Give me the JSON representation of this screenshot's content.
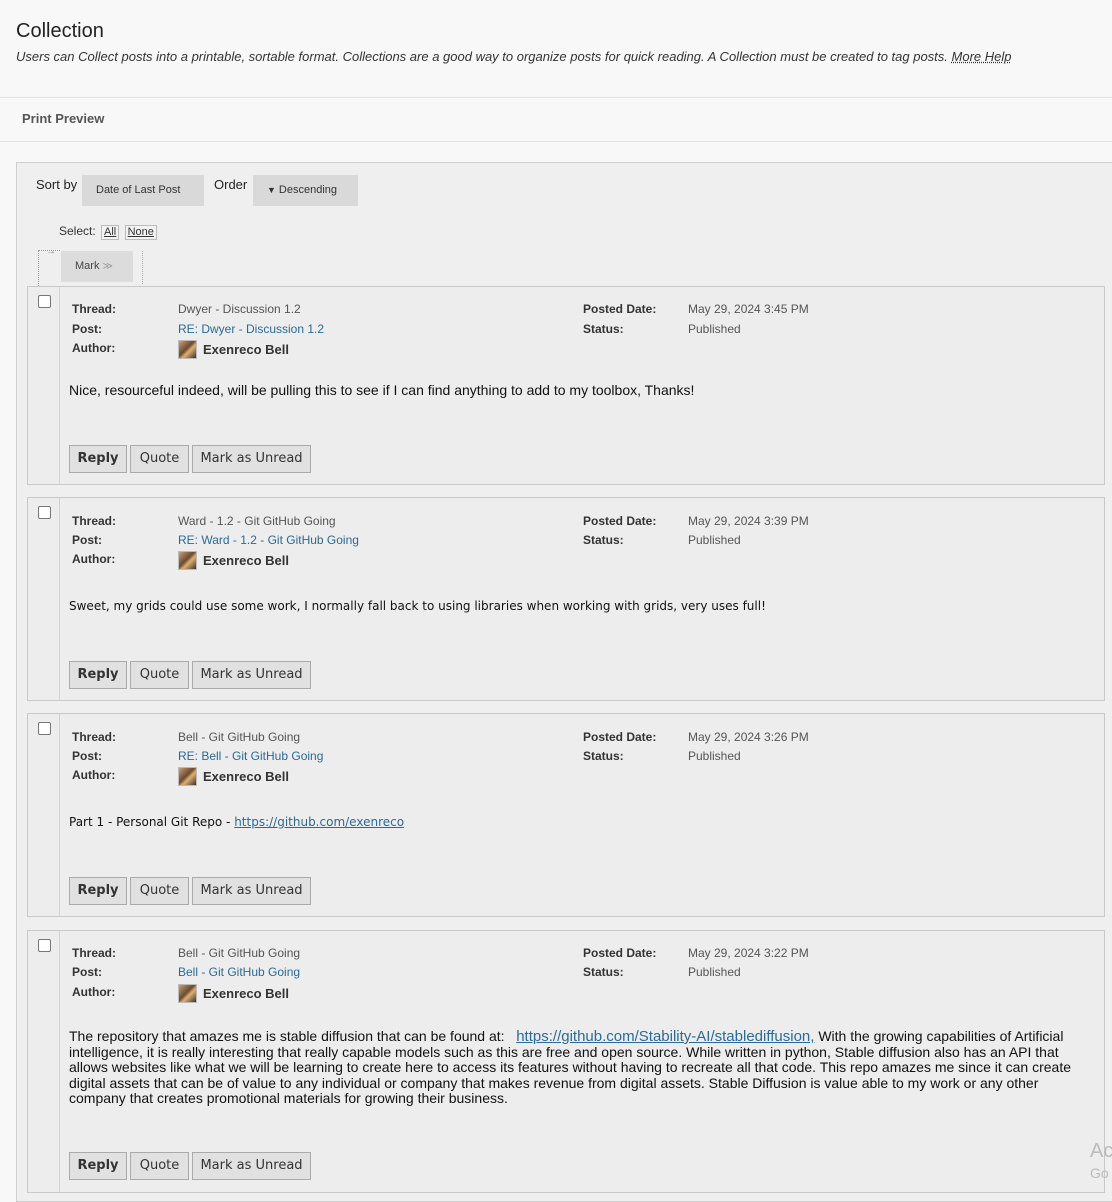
{
  "header": {
    "title": "Collection",
    "description": "Users can Collect posts into a printable, sortable format. Collections are a good way to organize posts for quick reading. A Collection must be created to tag posts.",
    "more_help": "More Help"
  },
  "toolbar": {
    "print_preview": "Print Preview",
    "sort_by_label": "Sort by",
    "sort_by_value": "Date of Last Post",
    "order_label": "Order",
    "order_value": "Descending",
    "select_label": "Select:",
    "select_all": "All",
    "select_none": "None",
    "mark_label": "Mark"
  },
  "labels": {
    "thread": "Thread:",
    "post": "Post:",
    "author": "Author:",
    "posted_date": "Posted Date:",
    "status": "Status:",
    "reply": "Reply",
    "quote": "Quote",
    "mark_unread": "Mark as Unread"
  },
  "posts": [
    {
      "thread": "Dwyer - Discussion 1.2",
      "post": "RE: Dwyer - Discussion 1.2",
      "author": "Exenreco Bell",
      "posted_date": "May 29, 2024 3:45 PM",
      "status": "Published",
      "body": "Nice, resourceful indeed, will be pulling this to see if I can find anything to add to my toolbox, Thanks!"
    },
    {
      "thread": "Ward - 1.2 - Git GitHub Going",
      "post": "RE: Ward - 1.2 - Git GitHub Going",
      "author": "Exenreco Bell",
      "posted_date": "May 29, 2024 3:39 PM",
      "status": "Published",
      "body": "Sweet, my grids could use some work, I normally fall back to using libraries when working with grids, very uses full!"
    },
    {
      "thread": "Bell - Git GitHub Going",
      "post": "RE: Bell - Git GitHub Going",
      "author": "Exenreco Bell",
      "posted_date": "May 29, 2024 3:26 PM",
      "status": "Published",
      "body_prefix": "Part 1 - Personal Git Repo - ",
      "body_link": "https://github.com/exenreco"
    },
    {
      "thread": "Bell - Git GitHub Going",
      "post": "Bell - Git GitHub Going",
      "author": "Exenreco Bell",
      "posted_date": "May 29, 2024 3:22 PM",
      "status": "Published",
      "body_prefix": "The repository that amazes me is stable diffusion that can be found at:",
      "body_link": "https://github.com/Stability-AI/stablediffusion,",
      "body_suffix": "With the growing capabilities of Artificial intelligence, it is really interesting that really capable models such as this are free and open source. While written in python, Stable diffusion also has an API that allows websites like what we will be learning to create here to access its features without having to recreate all that code. This repo amazes me since it can create digital assets that can be of value to any individual or company that makes revenue from digital assets. Stable Diffusion is value able to my work or any other company that creates promotional materials for growing their business."
    }
  ],
  "watermark": {
    "line1": "Ac",
    "line2": "Go"
  }
}
